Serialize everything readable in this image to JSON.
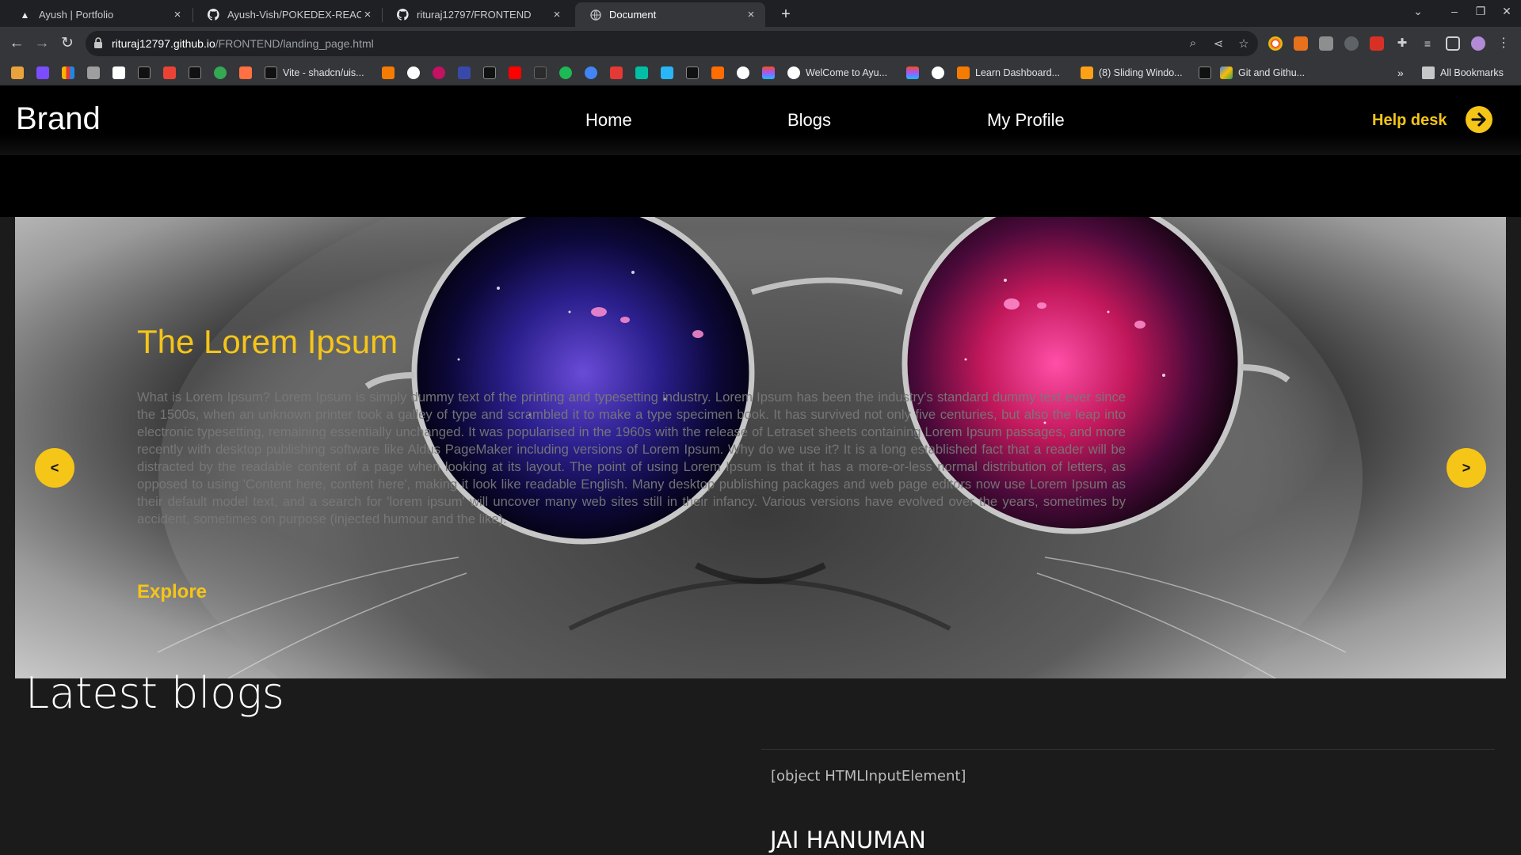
{
  "browser": {
    "tabs": [
      {
        "title": "Ayush | Portfolio",
        "icon": "triangle-logo-icon"
      },
      {
        "title": "Ayush-Vish/POKEDEX-REACT",
        "icon": "github-icon"
      },
      {
        "title": "rituraj12797/FRONTEND",
        "icon": "github-icon"
      },
      {
        "title": "Document",
        "icon": "globe-icon"
      }
    ],
    "close_glyph": "×",
    "new_tab_glyph": "+",
    "url_host": "rituraj12797.github.io",
    "url_path": "/FRONTEND/landing_page.html",
    "bookmarks": [
      {
        "label": "Vite - shadcn/uis..."
      },
      {
        "label": "WelCome to Ayu..."
      },
      {
        "label": "Learn Dashboard..."
      },
      {
        "label": "(8) Sliding Windo..."
      },
      {
        "label": "Git and Githu..."
      }
    ],
    "bookmarks_overflow": "»",
    "all_bookmarks": "All Bookmarks"
  },
  "site": {
    "brand": "Brand",
    "nav": {
      "home": "Home",
      "blogs": "Blogs",
      "profile": "My Profile"
    },
    "help_desk": "Help desk",
    "hero": {
      "title": "The Lorem Ipsum",
      "body": "What is Lorem Ipsum? Lorem Ipsum is simply dummy text of the printing and typesetting industry. Lorem Ipsum has been the industry's standard dummy text ever since the 1500s, when an unknown printer took a galley of type and scrambled it to make a type specimen book. It has survived not only five centuries, but also the leap into electronic typesetting, remaining essentially unchanged. It was popularised in the 1960s with the release of Letraset sheets containing Lorem Ipsum passages, and more recently with desktop publishing software like Aldus PageMaker including versions of Lorem Ipsum. Why do we use it? It is a long established fact that a reader will be distracted by the readable content of a page when looking at its layout. The point of using Lorem Ipsum is that it has a more-or-less normal distribution of letters, as opposed to using 'Content here, content here', making it look like readable English. Many desktop publishing packages and web page editors now use Lorem Ipsum as their default model text, and a search for 'lorem ipsum' will uncover many web sites still in their infancy. Various versions have evolved over the years, sometimes by accident, sometimes on purpose (injected humour and the like).",
      "explore": "Explore",
      "prev": "<",
      "next": ">"
    },
    "latest_blogs": "Latest blogs",
    "blog_input_text": "[object HTMLInputElement]",
    "blog_title": "JAI HANUMAN"
  },
  "colors": {
    "accent": "#f5c518",
    "nav_bg": "#000000",
    "page_bg": "#1b1b1b"
  }
}
